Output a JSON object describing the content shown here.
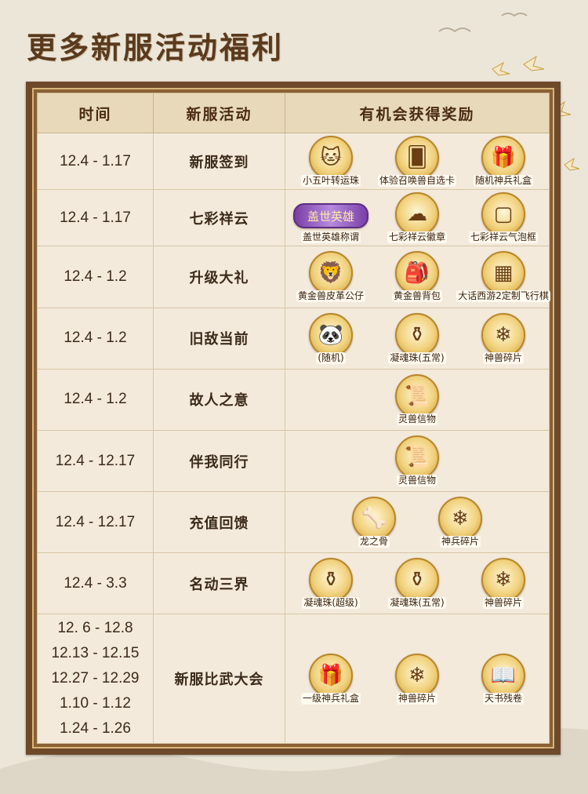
{
  "title": "更多新服活动福利",
  "headers": [
    "时间",
    "新服活动",
    "有机会获得奖励"
  ],
  "rows": [
    {
      "times": [
        "12.4 - 1.17"
      ],
      "activity": "新服签到",
      "rewards": [
        {
          "label": "小五叶转运珠",
          "icon": "gold-cat-icon",
          "glyph": "🐱"
        },
        {
          "label": "体验召唤兽自选卡",
          "icon": "red-card-icon",
          "glyph": "🂠"
        },
        {
          "label": "随机神兵礼盒",
          "icon": "weapon-chest-icon",
          "glyph": "🎁"
        }
      ]
    },
    {
      "times": [
        "12.4 - 1.17"
      ],
      "activity": "七彩祥云",
      "rewards": [
        {
          "label": "盖世英雄称谓",
          "icon": "title-banner-icon",
          "glyph": "盖世英雄"
        },
        {
          "label": "七彩祥云徽章",
          "icon": "rainbow-cloud-icon",
          "glyph": "☁"
        },
        {
          "label": "七彩祥云气泡框",
          "icon": "bubble-frame-icon",
          "glyph": "▢"
        }
      ]
    },
    {
      "times": [
        "12.4 - 1.2"
      ],
      "activity": "升级大礼",
      "rewards": [
        {
          "label": "黄金兽皮革公仔",
          "icon": "plush-icon",
          "glyph": "🦁"
        },
        {
          "label": "黄金兽背包",
          "icon": "backpack-icon",
          "glyph": "🎒"
        },
        {
          "label": "大话西游2定制飞行棋",
          "icon": "board-game-icon",
          "glyph": "▦"
        }
      ]
    },
    {
      "times": [
        "12.4 - 1.2"
      ],
      "activity": "旧敌当前",
      "rewards": [
        {
          "label": "(随机)",
          "icon": "panda-icon",
          "glyph": "🐼"
        },
        {
          "label": "凝魂珠(五常)",
          "icon": "gold-vase-icon",
          "glyph": "⚱"
        },
        {
          "label": "神兽碎片",
          "icon": "crystal-shards-icon",
          "glyph": "❄"
        }
      ]
    },
    {
      "times": [
        "12.4 - 1.2"
      ],
      "activity": "故人之意",
      "rewards": [
        {
          "label": "灵兽信物",
          "icon": "token-box-icon",
          "glyph": "📜"
        }
      ]
    },
    {
      "times": [
        "12.4 - 12.17"
      ],
      "activity": "伴我同行",
      "rewards": [
        {
          "label": "灵兽信物",
          "icon": "token-box-icon",
          "glyph": "📜"
        }
      ]
    },
    {
      "times": [
        "12.4 - 12.17"
      ],
      "activity": "充值回馈",
      "rewards": [
        {
          "label": "龙之骨",
          "icon": "dragon-bone-icon",
          "glyph": "🦴"
        },
        {
          "label": "神兵碎片",
          "icon": "crystal-shards-icon",
          "glyph": "❄"
        }
      ]
    },
    {
      "times": [
        "12.4 - 3.3"
      ],
      "activity": "名动三界",
      "rewards": [
        {
          "label": "凝魂珠(超级)",
          "icon": "blue-vase-icon",
          "glyph": "⚱"
        },
        {
          "label": "凝魂珠(五常)",
          "icon": "gold-vase-icon",
          "glyph": "⚱"
        },
        {
          "label": "神兽碎片",
          "icon": "crystal-shards-icon",
          "glyph": "❄"
        }
      ]
    },
    {
      "times": [
        "12. 6 - 12.8",
        "12.13 - 12.15",
        "12.27 - 12.29",
        "1.10 - 1.12",
        "1.24 - 1.26"
      ],
      "activity": "新服比武大会",
      "rewards": [
        {
          "label": "一级神兵礼盒",
          "icon": "weapon-chest-icon",
          "glyph": "🎁"
        },
        {
          "label": "神兽碎片",
          "icon": "crystal-shards-icon",
          "glyph": "❄"
        },
        {
          "label": "天书残卷",
          "icon": "scroll-icon",
          "glyph": "📖"
        }
      ]
    }
  ]
}
